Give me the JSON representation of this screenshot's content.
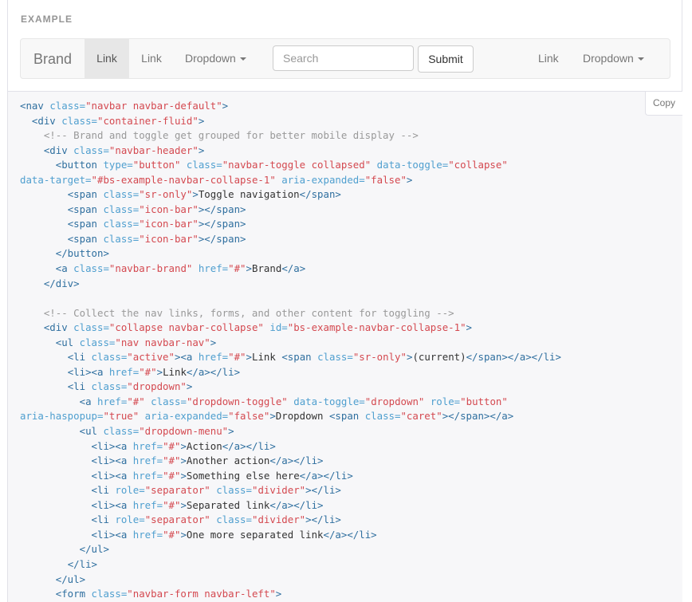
{
  "example": {
    "label": "EXAMPLE",
    "navbar": {
      "brand": "Brand",
      "left_links": [
        {
          "label": "Link",
          "active": true
        },
        {
          "label": "Link",
          "active": false
        }
      ],
      "left_dropdown": "Dropdown",
      "search_placeholder": "Search",
      "submit_label": "Submit",
      "right_link": "Link",
      "right_dropdown": "Dropdown"
    }
  },
  "code": {
    "copy_label": "Copy",
    "lines": [
      [
        [
          "tag",
          "<nav "
        ],
        [
          "attr",
          "class="
        ],
        [
          "val",
          "\"navbar navbar-default\""
        ],
        [
          "tag",
          ">"
        ]
      ],
      [
        [
          "text",
          "  "
        ],
        [
          "tag",
          "<div "
        ],
        [
          "attr",
          "class="
        ],
        [
          "val",
          "\"container-fluid\""
        ],
        [
          "tag",
          ">"
        ]
      ],
      [
        [
          "text",
          "    "
        ],
        [
          "comment",
          "<!-- Brand and toggle get grouped for better mobile display -->"
        ]
      ],
      [
        [
          "text",
          "    "
        ],
        [
          "tag",
          "<div "
        ],
        [
          "attr",
          "class="
        ],
        [
          "val",
          "\"navbar-header\""
        ],
        [
          "tag",
          ">"
        ]
      ],
      [
        [
          "text",
          "      "
        ],
        [
          "tag",
          "<button "
        ],
        [
          "attr",
          "type="
        ],
        [
          "val",
          "\"button\""
        ],
        [
          "text",
          " "
        ],
        [
          "attr",
          "class="
        ],
        [
          "val",
          "\"navbar-toggle collapsed\""
        ],
        [
          "text",
          " "
        ],
        [
          "attr",
          "data-toggle="
        ],
        [
          "val",
          "\"collapse\""
        ]
      ],
      [
        [
          "attr",
          "data-target="
        ],
        [
          "val",
          "\"#bs-example-navbar-collapse-1\""
        ],
        [
          "text",
          " "
        ],
        [
          "attr",
          "aria-expanded="
        ],
        [
          "val",
          "\"false\""
        ],
        [
          "tag",
          ">"
        ]
      ],
      [
        [
          "text",
          "        "
        ],
        [
          "tag",
          "<span "
        ],
        [
          "attr",
          "class="
        ],
        [
          "val",
          "\"sr-only\""
        ],
        [
          "tag",
          ">"
        ],
        [
          "text",
          "Toggle navigation"
        ],
        [
          "tag",
          "</span>"
        ]
      ],
      [
        [
          "text",
          "        "
        ],
        [
          "tag",
          "<span "
        ],
        [
          "attr",
          "class="
        ],
        [
          "val",
          "\"icon-bar\""
        ],
        [
          "tag",
          "></span>"
        ]
      ],
      [
        [
          "text",
          "        "
        ],
        [
          "tag",
          "<span "
        ],
        [
          "attr",
          "class="
        ],
        [
          "val",
          "\"icon-bar\""
        ],
        [
          "tag",
          "></span>"
        ]
      ],
      [
        [
          "text",
          "        "
        ],
        [
          "tag",
          "<span "
        ],
        [
          "attr",
          "class="
        ],
        [
          "val",
          "\"icon-bar\""
        ],
        [
          "tag",
          "></span>"
        ]
      ],
      [
        [
          "text",
          "      "
        ],
        [
          "tag",
          "</button>"
        ]
      ],
      [
        [
          "text",
          "      "
        ],
        [
          "tag",
          "<a "
        ],
        [
          "attr",
          "class="
        ],
        [
          "val",
          "\"navbar-brand\""
        ],
        [
          "text",
          " "
        ],
        [
          "attr",
          "href="
        ],
        [
          "val",
          "\"#\""
        ],
        [
          "tag",
          ">"
        ],
        [
          "text",
          "Brand"
        ],
        [
          "tag",
          "</a>"
        ]
      ],
      [
        [
          "text",
          "    "
        ],
        [
          "tag",
          "</div>"
        ]
      ],
      [
        [
          "text",
          ""
        ]
      ],
      [
        [
          "text",
          "    "
        ],
        [
          "comment",
          "<!-- Collect the nav links, forms, and other content for toggling -->"
        ]
      ],
      [
        [
          "text",
          "    "
        ],
        [
          "tag",
          "<div "
        ],
        [
          "attr",
          "class="
        ],
        [
          "val",
          "\"collapse navbar-collapse\""
        ],
        [
          "text",
          " "
        ],
        [
          "attr",
          "id="
        ],
        [
          "val",
          "\"bs-example-navbar-collapse-1\""
        ],
        [
          "tag",
          ">"
        ]
      ],
      [
        [
          "text",
          "      "
        ],
        [
          "tag",
          "<ul "
        ],
        [
          "attr",
          "class="
        ],
        [
          "val",
          "\"nav navbar-nav\""
        ],
        [
          "tag",
          ">"
        ]
      ],
      [
        [
          "text",
          "        "
        ],
        [
          "tag",
          "<li "
        ],
        [
          "attr",
          "class="
        ],
        [
          "val",
          "\"active\""
        ],
        [
          "tag",
          "><a "
        ],
        [
          "attr",
          "href="
        ],
        [
          "val",
          "\"#\""
        ],
        [
          "tag",
          ">"
        ],
        [
          "text",
          "Link "
        ],
        [
          "tag",
          "<span "
        ],
        [
          "attr",
          "class="
        ],
        [
          "val",
          "\"sr-only\""
        ],
        [
          "tag",
          ">"
        ],
        [
          "text",
          "(current)"
        ],
        [
          "tag",
          "</span></a></li>"
        ]
      ],
      [
        [
          "text",
          "        "
        ],
        [
          "tag",
          "<li><a "
        ],
        [
          "attr",
          "href="
        ],
        [
          "val",
          "\"#\""
        ],
        [
          "tag",
          ">"
        ],
        [
          "text",
          "Link"
        ],
        [
          "tag",
          "</a></li>"
        ]
      ],
      [
        [
          "text",
          "        "
        ],
        [
          "tag",
          "<li "
        ],
        [
          "attr",
          "class="
        ],
        [
          "val",
          "\"dropdown\""
        ],
        [
          "tag",
          ">"
        ]
      ],
      [
        [
          "text",
          "          "
        ],
        [
          "tag",
          "<a "
        ],
        [
          "attr",
          "href="
        ],
        [
          "val",
          "\"#\""
        ],
        [
          "text",
          " "
        ],
        [
          "attr",
          "class="
        ],
        [
          "val",
          "\"dropdown-toggle\""
        ],
        [
          "text",
          " "
        ],
        [
          "attr",
          "data-toggle="
        ],
        [
          "val",
          "\"dropdown\""
        ],
        [
          "text",
          " "
        ],
        [
          "attr",
          "role="
        ],
        [
          "val",
          "\"button\""
        ]
      ],
      [
        [
          "attr",
          "aria-haspopup="
        ],
        [
          "val",
          "\"true\""
        ],
        [
          "text",
          " "
        ],
        [
          "attr",
          "aria-expanded="
        ],
        [
          "val",
          "\"false\""
        ],
        [
          "tag",
          ">"
        ],
        [
          "text",
          "Dropdown "
        ],
        [
          "tag",
          "<span "
        ],
        [
          "attr",
          "class="
        ],
        [
          "val",
          "\"caret\""
        ],
        [
          "tag",
          "></span></a>"
        ]
      ],
      [
        [
          "text",
          "          "
        ],
        [
          "tag",
          "<ul "
        ],
        [
          "attr",
          "class="
        ],
        [
          "val",
          "\"dropdown-menu\""
        ],
        [
          "tag",
          ">"
        ]
      ],
      [
        [
          "text",
          "            "
        ],
        [
          "tag",
          "<li><a "
        ],
        [
          "attr",
          "href="
        ],
        [
          "val",
          "\"#\""
        ],
        [
          "tag",
          ">"
        ],
        [
          "text",
          "Action"
        ],
        [
          "tag",
          "</a></li>"
        ]
      ],
      [
        [
          "text",
          "            "
        ],
        [
          "tag",
          "<li><a "
        ],
        [
          "attr",
          "href="
        ],
        [
          "val",
          "\"#\""
        ],
        [
          "tag",
          ">"
        ],
        [
          "text",
          "Another action"
        ],
        [
          "tag",
          "</a></li>"
        ]
      ],
      [
        [
          "text",
          "            "
        ],
        [
          "tag",
          "<li><a "
        ],
        [
          "attr",
          "href="
        ],
        [
          "val",
          "\"#\""
        ],
        [
          "tag",
          ">"
        ],
        [
          "text",
          "Something else here"
        ],
        [
          "tag",
          "</a></li>"
        ]
      ],
      [
        [
          "text",
          "            "
        ],
        [
          "tag",
          "<li "
        ],
        [
          "attr",
          "role="
        ],
        [
          "val",
          "\"separator\""
        ],
        [
          "text",
          " "
        ],
        [
          "attr",
          "class="
        ],
        [
          "val",
          "\"divider\""
        ],
        [
          "tag",
          "></li>"
        ]
      ],
      [
        [
          "text",
          "            "
        ],
        [
          "tag",
          "<li><a "
        ],
        [
          "attr",
          "href="
        ],
        [
          "val",
          "\"#\""
        ],
        [
          "tag",
          ">"
        ],
        [
          "text",
          "Separated link"
        ],
        [
          "tag",
          "</a></li>"
        ]
      ],
      [
        [
          "text",
          "            "
        ],
        [
          "tag",
          "<li "
        ],
        [
          "attr",
          "role="
        ],
        [
          "val",
          "\"separator\""
        ],
        [
          "text",
          " "
        ],
        [
          "attr",
          "class="
        ],
        [
          "val",
          "\"divider\""
        ],
        [
          "tag",
          "></li>"
        ]
      ],
      [
        [
          "text",
          "            "
        ],
        [
          "tag",
          "<li><a "
        ],
        [
          "attr",
          "href="
        ],
        [
          "val",
          "\"#\""
        ],
        [
          "tag",
          ">"
        ],
        [
          "text",
          "One more separated link"
        ],
        [
          "tag",
          "</a></li>"
        ]
      ],
      [
        [
          "text",
          "          "
        ],
        [
          "tag",
          "</ul>"
        ]
      ],
      [
        [
          "text",
          "        "
        ],
        [
          "tag",
          "</li>"
        ]
      ],
      [
        [
          "text",
          "      "
        ],
        [
          "tag",
          "</ul>"
        ]
      ],
      [
        [
          "text",
          "      "
        ],
        [
          "tag",
          "<form "
        ],
        [
          "attr",
          "class="
        ],
        [
          "val",
          "\"navbar-form navbar-left\""
        ],
        [
          "tag",
          ">"
        ]
      ]
    ]
  }
}
